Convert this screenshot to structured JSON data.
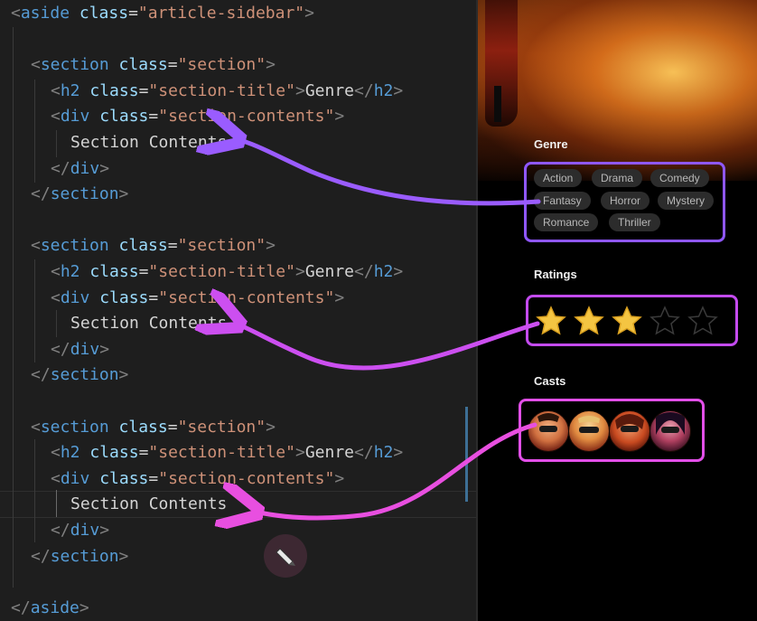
{
  "editor": {
    "lines": [
      [
        {
          "t": "<",
          "k": "bracket"
        },
        {
          "t": "aside",
          "k": "tag"
        },
        {
          "t": " ",
          "k": "text"
        },
        {
          "t": "class",
          "k": "attr"
        },
        {
          "t": "=",
          "k": "text"
        },
        {
          "t": "\"article-sidebar\"",
          "k": "str"
        },
        {
          "t": ">",
          "k": "bracket"
        }
      ],
      [],
      [
        {
          "t": "<",
          "k": "bracket"
        },
        {
          "t": "section",
          "k": "tag"
        },
        {
          "t": " ",
          "k": "text"
        },
        {
          "t": "class",
          "k": "attr"
        },
        {
          "t": "=",
          "k": "text"
        },
        {
          "t": "\"section\"",
          "k": "str"
        },
        {
          "t": ">",
          "k": "bracket"
        }
      ],
      [
        {
          "t": "<",
          "k": "bracket"
        },
        {
          "t": "h2",
          "k": "tag"
        },
        {
          "t": " ",
          "k": "text"
        },
        {
          "t": "class",
          "k": "attr"
        },
        {
          "t": "=",
          "k": "text"
        },
        {
          "t": "\"section-title\"",
          "k": "str"
        },
        {
          "t": ">",
          "k": "bracket"
        },
        {
          "t": "Genre",
          "k": "text"
        },
        {
          "t": "</",
          "k": "bracket"
        },
        {
          "t": "h2",
          "k": "tag"
        },
        {
          "t": ">",
          "k": "bracket"
        }
      ],
      [
        {
          "t": "<",
          "k": "bracket"
        },
        {
          "t": "div",
          "k": "tag"
        },
        {
          "t": " ",
          "k": "text"
        },
        {
          "t": "class",
          "k": "attr"
        },
        {
          "t": "=",
          "k": "text"
        },
        {
          "t": "\"section-contents\"",
          "k": "str"
        },
        {
          "t": ">",
          "k": "bracket"
        }
      ],
      [
        {
          "t": "Section Contents",
          "k": "text"
        }
      ],
      [
        {
          "t": "</",
          "k": "bracket"
        },
        {
          "t": "div",
          "k": "tag"
        },
        {
          "t": ">",
          "k": "bracket"
        }
      ],
      [
        {
          "t": "</",
          "k": "bracket"
        },
        {
          "t": "section",
          "k": "tag"
        },
        {
          "t": ">",
          "k": "bracket"
        }
      ],
      [],
      [
        {
          "t": "<",
          "k": "bracket"
        },
        {
          "t": "section",
          "k": "tag"
        },
        {
          "t": " ",
          "k": "text"
        },
        {
          "t": "class",
          "k": "attr"
        },
        {
          "t": "=",
          "k": "text"
        },
        {
          "t": "\"section\"",
          "k": "str"
        },
        {
          "t": ">",
          "k": "bracket"
        }
      ],
      [
        {
          "t": "<",
          "k": "bracket"
        },
        {
          "t": "h2",
          "k": "tag"
        },
        {
          "t": " ",
          "k": "text"
        },
        {
          "t": "class",
          "k": "attr"
        },
        {
          "t": "=",
          "k": "text"
        },
        {
          "t": "\"section-title\"",
          "k": "str"
        },
        {
          "t": ">",
          "k": "bracket"
        },
        {
          "t": "Genre",
          "k": "text"
        },
        {
          "t": "</",
          "k": "bracket"
        },
        {
          "t": "h2",
          "k": "tag"
        },
        {
          "t": ">",
          "k": "bracket"
        }
      ],
      [
        {
          "t": "<",
          "k": "bracket"
        },
        {
          "t": "div",
          "k": "tag"
        },
        {
          "t": " ",
          "k": "text"
        },
        {
          "t": "class",
          "k": "attr"
        },
        {
          "t": "=",
          "k": "text"
        },
        {
          "t": "\"section-contents\"",
          "k": "str"
        },
        {
          "t": ">",
          "k": "bracket"
        }
      ],
      [
        {
          "t": "Section Contents",
          "k": "text"
        }
      ],
      [
        {
          "t": "</",
          "k": "bracket"
        },
        {
          "t": "div",
          "k": "tag"
        },
        {
          "t": ">",
          "k": "bracket"
        }
      ],
      [
        {
          "t": "</",
          "k": "bracket"
        },
        {
          "t": "section",
          "k": "tag"
        },
        {
          "t": ">",
          "k": "bracket"
        }
      ],
      [],
      [
        {
          "t": "<",
          "k": "bracket"
        },
        {
          "t": "section",
          "k": "tag"
        },
        {
          "t": " ",
          "k": "text"
        },
        {
          "t": "class",
          "k": "attr"
        },
        {
          "t": "=",
          "k": "text"
        },
        {
          "t": "\"section\"",
          "k": "str"
        },
        {
          "t": ">",
          "k": "bracket"
        }
      ],
      [
        {
          "t": "<",
          "k": "bracket"
        },
        {
          "t": "h2",
          "k": "tag"
        },
        {
          "t": " ",
          "k": "text"
        },
        {
          "t": "class",
          "k": "attr"
        },
        {
          "t": "=",
          "k": "text"
        },
        {
          "t": "\"section-title\"",
          "k": "str"
        },
        {
          "t": ">",
          "k": "bracket"
        },
        {
          "t": "Genre",
          "k": "text"
        },
        {
          "t": "</",
          "k": "bracket"
        },
        {
          "t": "h2",
          "k": "tag"
        },
        {
          "t": ">",
          "k": "bracket"
        }
      ],
      [
        {
          "t": "<",
          "k": "bracket"
        },
        {
          "t": "div",
          "k": "tag"
        },
        {
          "t": " ",
          "k": "text"
        },
        {
          "t": "class",
          "k": "attr"
        },
        {
          "t": "=",
          "k": "text"
        },
        {
          "t": "\"section-contents\"",
          "k": "str"
        },
        {
          "t": ">",
          "k": "bracket"
        }
      ],
      [
        {
          "t": "Section Contents",
          "k": "text"
        }
      ],
      [
        {
          "t": "</",
          "k": "bracket"
        },
        {
          "t": "div",
          "k": "tag"
        },
        {
          "t": ">",
          "k": "bracket"
        }
      ],
      [
        {
          "t": "</",
          "k": "bracket"
        },
        {
          "t": "section",
          "k": "tag"
        },
        {
          "t": ">",
          "k": "bracket"
        }
      ],
      [],
      [
        {
          "t": "</",
          "k": "bracket"
        },
        {
          "t": "aside",
          "k": "tag"
        },
        {
          "t": ">",
          "k": "bracket"
        }
      ]
    ]
  },
  "preview": {
    "genre": {
      "title": "Genre",
      "chips": [
        "Action",
        "Drama",
        "Comedy",
        "Fantasy",
        "Horror",
        "Mystery",
        "Romance",
        "Thriller"
      ]
    },
    "ratings": {
      "title": "Ratings",
      "filled": 3,
      "total": 5
    },
    "casts": {
      "title": "Casts",
      "members": [
        "cast-avatar-1",
        "cast-avatar-2",
        "cast-avatar-3",
        "cast-avatar-4"
      ]
    }
  },
  "colors": {
    "genre_highlight": "#8f57ff",
    "ratings_highlight": "#c44bf0",
    "casts_highlight": "#e24fe8",
    "star_fill": "#f4c542"
  }
}
